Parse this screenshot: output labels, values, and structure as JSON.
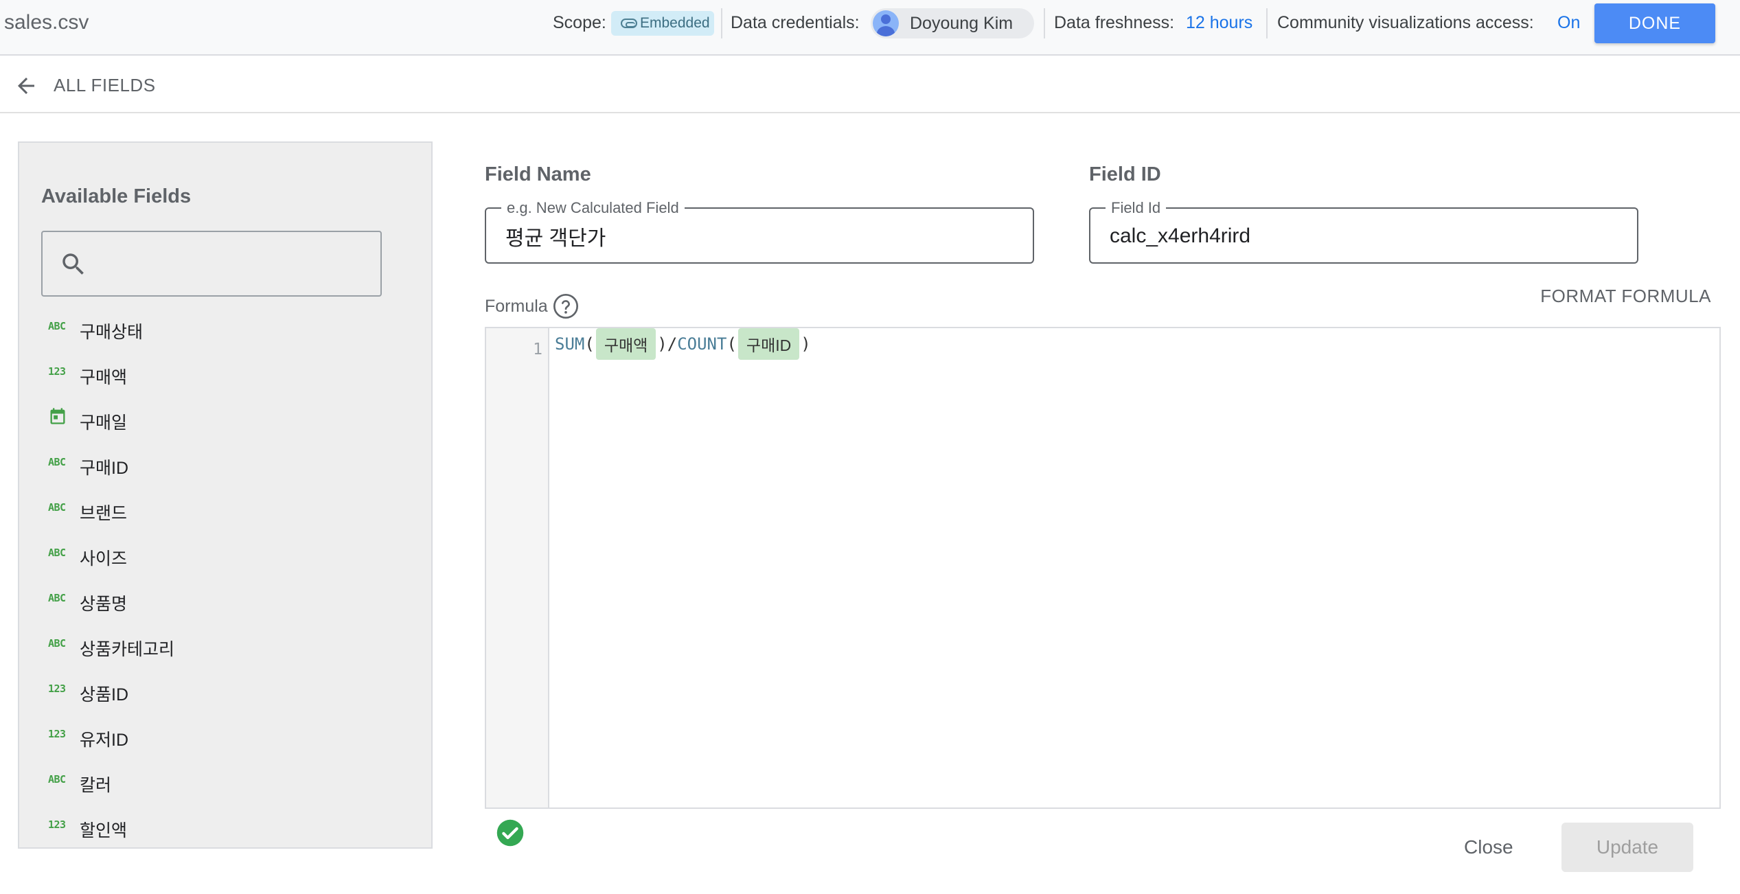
{
  "header": {
    "title": "sales.csv",
    "scope_label": "Scope:",
    "scope_value": "Embedded",
    "credentials_label": "Data credentials:",
    "credentials_user": "Doyoung Kim",
    "freshness_label": "Data freshness:",
    "freshness_value": "12 hours",
    "community_label": "Community visualizations access:",
    "community_value": "On",
    "done_label": "DONE"
  },
  "nav": {
    "back_label": "ALL FIELDS"
  },
  "left_panel": {
    "title": "Available Fields",
    "search_placeholder": "",
    "fields": [
      {
        "type": "ABC",
        "name": "구매상태"
      },
      {
        "type": "123",
        "name": "구매액"
      },
      {
        "type": "calendar-icon",
        "name": "구매일"
      },
      {
        "type": "ABC",
        "name": "구매ID"
      },
      {
        "type": "ABC",
        "name": "브랜드"
      },
      {
        "type": "ABC",
        "name": "사이즈"
      },
      {
        "type": "ABC",
        "name": "상품명"
      },
      {
        "type": "ABC",
        "name": "상품카테고리"
      },
      {
        "type": "123",
        "name": "상품ID"
      },
      {
        "type": "123",
        "name": "유저ID"
      },
      {
        "type": "ABC",
        "name": "칼러"
      },
      {
        "type": "123",
        "name": "할인액"
      }
    ]
  },
  "form": {
    "field_name_label": "Field Name",
    "field_name_legend": "e.g. New Calculated Field",
    "field_name_value": "평균 객단가",
    "field_id_label": "Field ID",
    "field_id_legend": "Field Id",
    "field_id_value": "calc_x4erh4rird",
    "formula_label": "Formula",
    "format_formula_label": "FORMAT FORMULA",
    "line_number": "1",
    "formula": {
      "fn1": "SUM",
      "open1": "(",
      "arg1": "구매액",
      "close1": ")",
      "op": "/",
      "fn2": "COUNT",
      "open2": "(",
      "arg2": "구매ID",
      "close2": ")"
    },
    "close_label": "Close",
    "update_label": "Update"
  },
  "colors": {
    "accent": "#4c8bf5",
    "link": "#1a73e8",
    "type_icon": "#43a047",
    "chip": "#c8e6c9",
    "valid": "#34a853"
  }
}
